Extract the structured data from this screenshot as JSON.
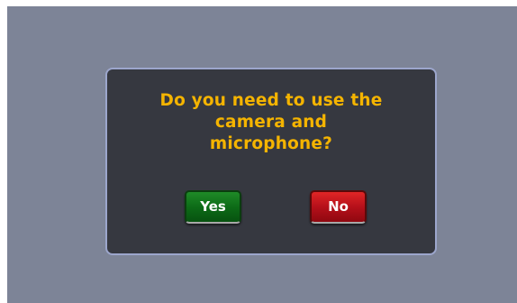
{
  "dialog": {
    "question_lines": [
      "Do you need to use the",
      "camera and",
      "microphone?"
    ],
    "yes_label": "Yes",
    "no_label": "No"
  },
  "colors": {
    "backdrop": "#7d8497",
    "dialog_background": "#363840",
    "dialog_border": "#9ca6cc",
    "question_text": "#f5b400",
    "yes_button": "#0d6b17",
    "no_button": "#b5101a",
    "button_text": "#ffffff"
  }
}
